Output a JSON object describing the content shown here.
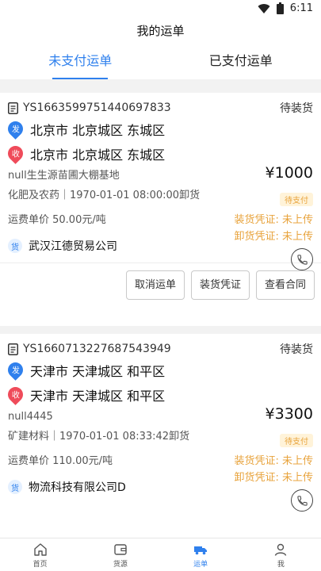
{
  "status": {
    "time": "6:11"
  },
  "header": {
    "title": "我的运单"
  },
  "tabs": [
    {
      "label": "未支付运单",
      "active": true
    },
    {
      "label": "已支付运单",
      "active": false
    }
  ],
  "orders": [
    {
      "order_no": "YS1663599751440697833",
      "state": "待装货",
      "send_icon": "发",
      "recv_icon": "收",
      "from": "北京市 北京城区 东城区",
      "to": "北京市 北京城区 东城区",
      "price": "¥1000",
      "pay_badge": "待支付",
      "site": "null生生源苗圃大棚基地",
      "cargo": "化肥及农药｜1970-01-01 08:00:00卸货",
      "load_proof": "装货凭证: 未上传",
      "unload_proof": "卸货凭证: 未上传",
      "unit_price": "运费单价 50.00元/吨",
      "huo_icon": "货",
      "company": "武汉江德贸易公司",
      "btn_cancel": "取消运单",
      "btn_load": "装货凭证",
      "btn_contract": "查看合同"
    },
    {
      "order_no": "YS1660713227687543949",
      "state": "待装货",
      "send_icon": "发",
      "recv_icon": "收",
      "from": "天津市 天津城区 和平区",
      "to": "天津市 天津城区 和平区",
      "price": "¥3300",
      "pay_badge": "待支付",
      "site": "null4445",
      "cargo": "矿建材料｜1970-01-01 08:33:42卸货",
      "load_proof": "装货凭证: 未上传",
      "unload_proof": "卸货凭证: 未上传",
      "unit_price": "运费单价 110.00元/吨",
      "huo_icon": "货",
      "company": "物流科技有限公司D"
    }
  ],
  "tabbar": [
    {
      "label": "首页",
      "icon": "home-icon"
    },
    {
      "label": "货源",
      "icon": "wallet-icon"
    },
    {
      "label": "运单",
      "icon": "truck-icon",
      "active": true
    },
    {
      "label": "我",
      "icon": "user-icon"
    }
  ],
  "colors": {
    "accent": "#2f80ed",
    "warn": "#e8a33c",
    "recv": "#ef4b5a"
  }
}
